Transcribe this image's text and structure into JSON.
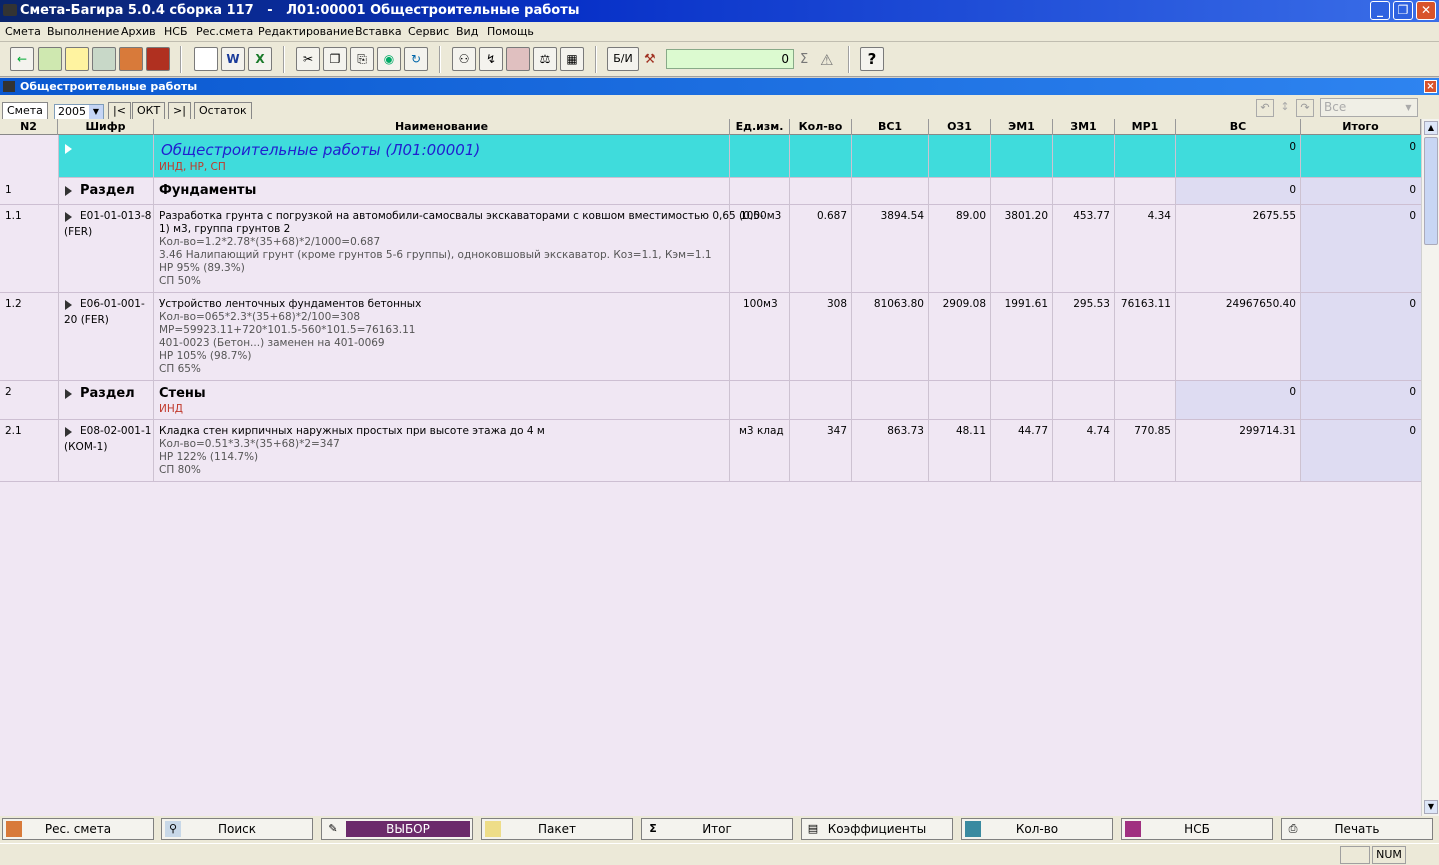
{
  "window": {
    "title": "Смета-Багира 5.0.4 сборка 117   -   Л01:00001 Общестроительные работы",
    "child_title": "Общестроительные работы",
    "controls": [
      "_",
      "❐",
      "✕"
    ]
  },
  "menu": [
    "Смета",
    "Выполнение",
    "Архив",
    "НСБ",
    "Рес.смета",
    "Редактирование",
    "Вставка",
    "Сервис",
    "Вид",
    "Помощь"
  ],
  "toolbar": {
    "bi_label": "Б/И",
    "sum_value": "0",
    "sigma": "Σ",
    "warn": "⚠",
    "help": "?"
  },
  "tabs": {
    "smeta": "Смета",
    "year": "2005",
    "nav_first": "|<",
    "month": "ОКТ",
    "nav_last": ">|",
    "remainder": "Остаток",
    "filter": "Все"
  },
  "columns": [
    "N2",
    "Шифр",
    "Наименование",
    "Ед.изм.",
    "Кол-во",
    "ВС1",
    "ОЗ1",
    "ЭМ1",
    "ЗМ1",
    "МР1",
    "ВС",
    "Итого"
  ],
  "rows": {
    "top": {
      "name": "Общестроительные работы (Л01:00001)",
      "sub": "ИНД, НР, СП",
      "vs": "0",
      "total": "0"
    },
    "r1": {
      "n": "1",
      "code": "Раздел",
      "name": "Фундаменты",
      "vs": "0",
      "total": "0"
    },
    "r11": {
      "n": "1.1",
      "code1": "Е01-01-013-8",
      "code2": "(FER)",
      "name1": "Разработка грунта с погрузкой на автомобили-самосвалы экскаваторами с ковшом вместимостью 0,65 (0,5-",
      "name2": "1) м3, группа грунтов 2",
      "g1": "Кол-во=1.2*2.78*(35+68)*2/1000=0.687",
      "g2": "3.46 Налипающий грунт (кроме грунтов 5-6 группы), одноковшовый экскаватор. Коз=1.1, Кэм=1.1",
      "g3": "НР 95% (89.3%)",
      "g4": "СП 50%",
      "unit": "1000м3",
      "qty": "0.687",
      "vs1": "3894.54",
      "oz1": "89.00",
      "em1": "3801.20",
      "zm1": "453.77",
      "mr1": "4.34",
      "vs": "2675.55",
      "total": "0"
    },
    "r12": {
      "n": "1.2",
      "code1": "Е06-01-001-",
      "code2": "20 (FER)",
      "name1": "Устройство ленточных фундаментов бетонных",
      "g1": "Кол-во=065*2.3*(35+68)*2/100=308",
      "g2": "МР=59923.11+720*101.5-560*101.5=76163.11",
      "g3": "401-0023 (Бетон...) заменен на 401-0069",
      "g4": "НР 105% (98.7%)",
      "g5": "СП 65%",
      "unit": "100м3",
      "qty": "308",
      "vs1": "81063.80",
      "oz1": "2909.08",
      "em1": "1991.61",
      "zm1": "295.53",
      "mr1": "76163.11",
      "vs": "24967650.40",
      "total": "0"
    },
    "r2": {
      "n": "2",
      "code": "Раздел",
      "name": "Стены",
      "sub": "ИНД",
      "vs": "0",
      "total": "0"
    },
    "r21": {
      "n": "2.1",
      "code1": "Е08-02-001-1",
      "code2": "(КОМ-1)",
      "name1": "Кладка стен кирпичных наружных простых при высоте этажа до 4 м",
      "g1": "Кол-во=0.51*3.3*(35+68)*2=347",
      "g2": "НР 122% (114.7%)",
      "g3": "СП 80%",
      "unit": "м3 клад",
      "qty": "347",
      "vs1": "863.73",
      "oz1": "48.11",
      "em1": "44.77",
      "zm1": "4.74",
      "mr1": "770.85",
      "vs": "299714.31",
      "total": "0"
    }
  },
  "bottom_buttons": [
    "Рес. смета",
    "Поиск",
    "ВЫБОР",
    "Пакет",
    "Итог",
    "Коэффициенты",
    "Кол-во",
    "НСБ",
    "Печать"
  ],
  "status": {
    "num": "NUM"
  },
  "colors": {
    "highlight_row": "#3fdcdc",
    "grid_bg": "#f0e7f3",
    "vs_col_bg": "#dedcf2",
    "title_blue": "#0831c8",
    "italic_blue": "#2020d0",
    "inactive_red": "#c0392b"
  }
}
